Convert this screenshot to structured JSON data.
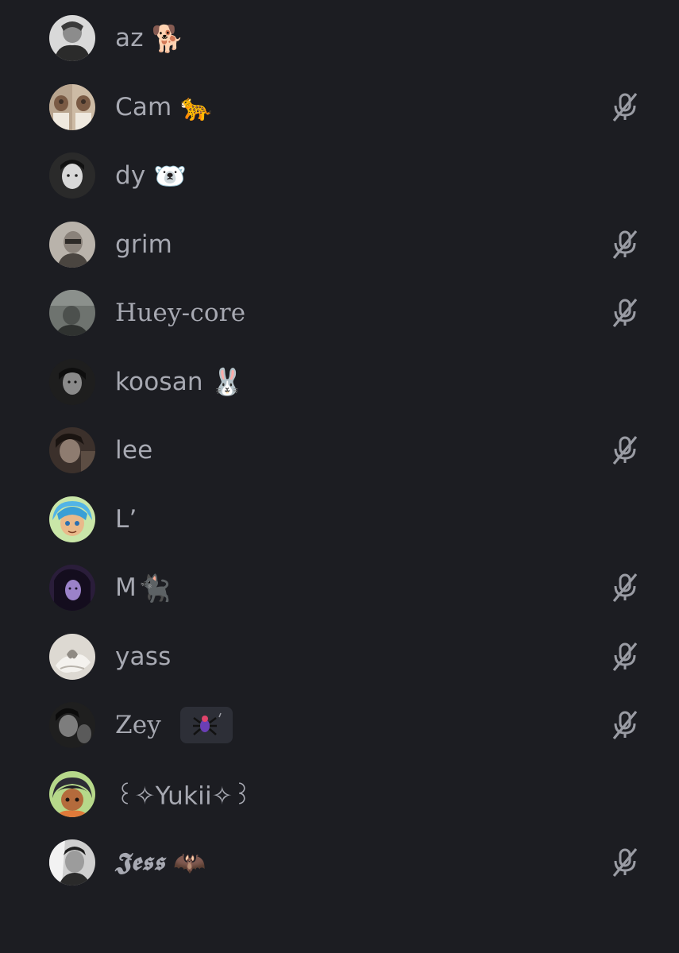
{
  "members": [
    {
      "name": "az",
      "emoji": "🐕",
      "muted": false,
      "avatar": {
        "bg": "#d9d9d9",
        "fg": "#2b2b2b"
      }
    },
    {
      "name": "Cam",
      "emoji": "🐆",
      "muted": true,
      "avatar": {
        "bg": "#cdbba5",
        "fg": "#3d2f26"
      }
    },
    {
      "name": "dy",
      "emoji": "🐻‍❄️",
      "muted": false,
      "avatar": {
        "bg": "#2a2a2a",
        "fg": "#e4e4e4"
      }
    },
    {
      "name": "grim",
      "emoji": "",
      "muted": true,
      "avatar": {
        "bg": "#b9b3ab",
        "fg": "#4a4540"
      }
    },
    {
      "name": "Huey-core",
      "emoji": "",
      "muted": true,
      "avatar": {
        "bg": "#6e736f",
        "fg": "#2f3230"
      }
    },
    {
      "name": "koosan",
      "emoji": "🐰",
      "muted": false,
      "avatar": {
        "bg": "#1e1e1e",
        "fg": "#8a8a8a"
      }
    },
    {
      "name": "lee",
      "emoji": "",
      "muted": true,
      "avatar": {
        "bg": "#3b302b",
        "fg": "#8e7c70"
      }
    },
    {
      "name": "L’",
      "emoji": "",
      "muted": false,
      "avatar": {
        "bg": "#52b4e6",
        "fg": "#e9b98a"
      }
    },
    {
      "name": "M",
      "emoji": "🐈‍⬛",
      "muted": true,
      "avatar": {
        "bg": "#2a1d3a",
        "fg": "#9b82c9"
      }
    },
    {
      "name": "yass",
      "emoji": "",
      "muted": true,
      "avatar": {
        "bg": "#ddd9d2",
        "fg": "#8f8a83"
      }
    },
    {
      "name": "Zey",
      "emoji": "",
      "muted": true,
      "badge": "spider-badge",
      "avatar": {
        "bg": "#1f1f1f",
        "fg": "#7d7d7d"
      }
    },
    {
      "name": "꒰✧Yukii✧꒱",
      "emoji": "",
      "muted": false,
      "avatar": {
        "bg": "#2c2b34",
        "fg": "#b46b3c"
      }
    },
    {
      "name": "𝕵𝖊𝖘𝖘",
      "emoji": "🦇",
      "muted": true,
      "avatar": {
        "bg": "#cfcfcf",
        "fg": "#2a2a2a"
      }
    }
  ],
  "colors": {
    "background": "#1c1d22",
    "text": "#a7a9b2",
    "mute_icon": "#9a9ca4",
    "badge_bg": "#2d2f37"
  },
  "icons": {
    "mute": "microphone-muted-icon"
  }
}
